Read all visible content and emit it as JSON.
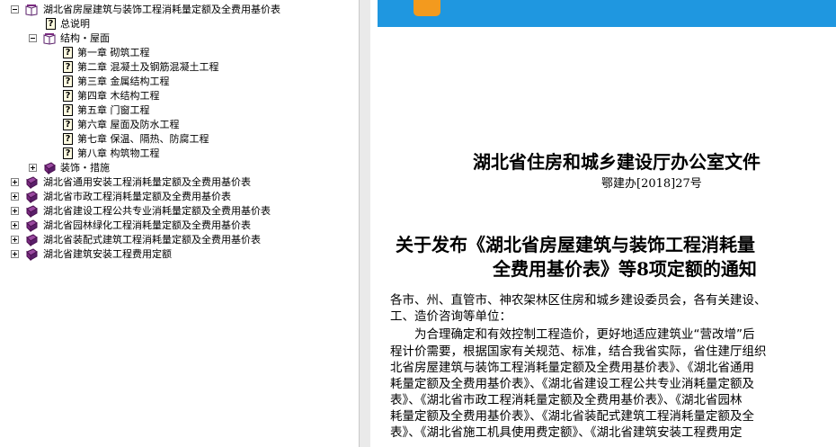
{
  "tree": {
    "root": "湖北省房屋建筑与装饰工程消耗量定额及全费用基价表",
    "summary": "总说明",
    "structure_folder": "结构・屋面",
    "chapters": [
      "第一章  砌筑工程",
      "第二章  混凝土及钢筋混凝土工程",
      "第三章  金属结构工程",
      "第四章  木结构工程",
      "第五章  门窗工程",
      "第六章  屋面及防水工程",
      "第七章  保温、隔热、防腐工程",
      "第八章  构筑物工程"
    ],
    "decoration_folder": "装饰・措施",
    "other_books": [
      "湖北省通用安装工程消耗量定额及全费用基价表",
      "湖北省市政工程消耗量定额及全费用基价表",
      "湖北省建设工程公共专业消耗量定额及全费用基价表",
      "湖北省园林绿化工程消耗量定额及全费用基价表",
      "湖北省装配式建筑工程消耗量定额及全费用基价表",
      "湖北省建筑安装工程费用定额"
    ]
  },
  "document": {
    "office": "湖北省住房和城乡建设厅办公室文件",
    "number": "鄂建办[2018]27号",
    "title_line1": "关于发布《湖北省房屋建筑与装饰工程消耗量",
    "title_line2": "全费用基价表》等8项定额的通知",
    "paragraphs": [
      "各市、州、直管市、神农架林区住房和城乡建设委员会，各有关建设、",
      "工、造价咨询等单位：",
      "　　为合理确定和有效控制工程造价，更好地适应建筑业“营改增”后",
      "程计价需要，根据国家有关规范、标准，结合我省实际，省住建厅组织",
      "北省房屋建筑与装饰工程消耗量定额及全费用基价表》、《湖北省通用",
      "耗量定额及全费用基价表》、《湖北省建设工程公共专业消耗量定额及",
      "表》、《湖北省市政工程消耗量定额及全费用基价表》、《湖北省园林",
      "耗量定额及全费用基价表》、《湖北省装配式建筑工程消耗量定额及全",
      "表》、《湖北省施工机具使用费定额》、《湖北省建筑安装工程费用定"
    ]
  },
  "colors": {
    "banner": "#1f97e0",
    "book_icon": "#7a2a80"
  }
}
